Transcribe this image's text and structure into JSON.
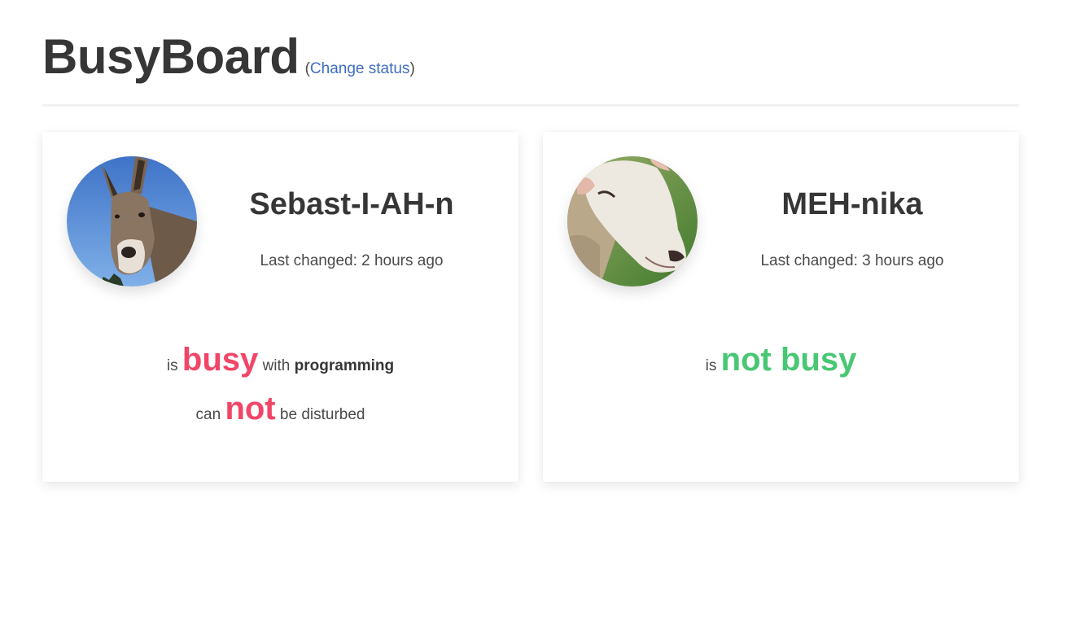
{
  "header": {
    "title": "BusyBoard",
    "paren_open": "(",
    "change_status_label": "Change status",
    "paren_close": ")"
  },
  "people": [
    {
      "name": "Sebast-I-AH-n",
      "avatar": "donkey-avatar",
      "last_changed": "Last changed: 2 hours ago",
      "status": {
        "is_word": "is",
        "state": "busy",
        "with_word": "with",
        "activity": "programming",
        "can_word": "can",
        "disturb_state": "not",
        "disturb_suffix": "be disturbed"
      }
    },
    {
      "name": "MEH-nika",
      "avatar": "sheep-avatar",
      "last_changed": "Last changed: 3 hours ago",
      "status": {
        "is_word": "is",
        "state": "not busy"
      }
    }
  ],
  "colors": {
    "busy": "#f14668",
    "not_busy": "#48c774",
    "link": "#3e6cc4",
    "text": "#363636"
  }
}
